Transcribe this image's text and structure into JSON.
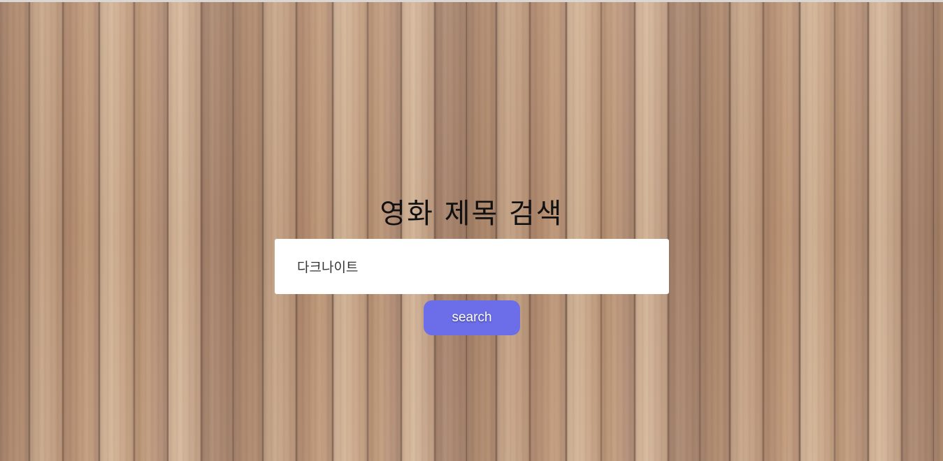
{
  "page": {
    "title": "영화 제목 검색"
  },
  "search": {
    "value": "다크나이트",
    "button_label": "search"
  },
  "colors": {
    "button_background": "#6b6ee8",
    "button_text": "#ffffff",
    "input_background": "#ffffff",
    "title_text": "#111111"
  }
}
